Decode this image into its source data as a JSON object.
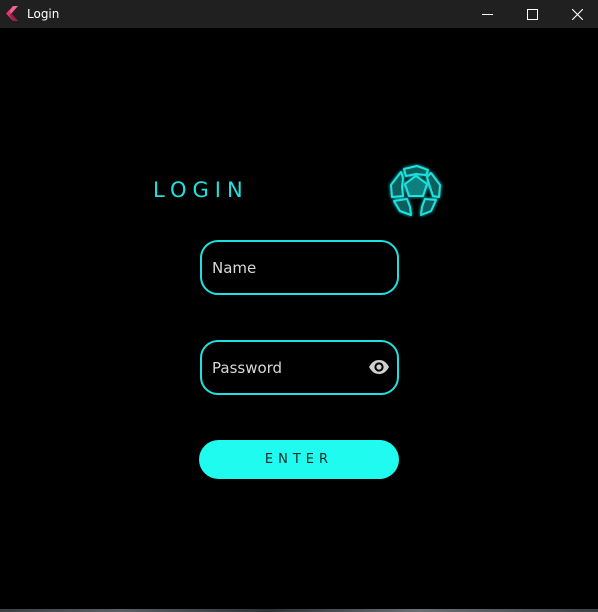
{
  "window": {
    "title": "Login",
    "app_icon": "flutter-icon",
    "controls": [
      "minimize-icon",
      "maximize-icon",
      "close-icon"
    ]
  },
  "login": {
    "heading": "LOGIN",
    "logo_icon": "dodecahedron-logo-icon",
    "name_placeholder": "Name",
    "name_value": "",
    "password_placeholder": "Password",
    "password_value": "",
    "password_toggle_icon": "eye-icon",
    "enter_label": "ENTER"
  },
  "colors": {
    "accent": "#1de3e0",
    "button_fill": "#1ffcef",
    "background": "#000000",
    "titlebar": "#202020"
  }
}
